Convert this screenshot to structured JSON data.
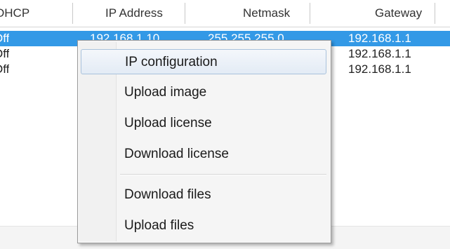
{
  "table": {
    "columns": [
      "DHCP",
      "IP Address",
      "Netmask",
      "Gateway"
    ],
    "rows": [
      {
        "dhcp": "Off",
        "ip": "192.168.1.10",
        "netmask": "255.255.255.0",
        "gateway": "192.168.1.1",
        "selected": true
      },
      {
        "dhcp": "Off",
        "ip": "",
        "netmask": "",
        "gateway": "192.168.1.1",
        "selected": false
      },
      {
        "dhcp": "Off",
        "ip": "",
        "netmask": "",
        "gateway": "192.168.1.1",
        "selected": false
      }
    ]
  },
  "context_menu": {
    "items": [
      {
        "label": "IP configuration",
        "hovered": true
      },
      {
        "label": "Upload image"
      },
      {
        "label": "Upload license"
      },
      {
        "label": "Download license"
      },
      {
        "label": "Download files"
      },
      {
        "label": "Upload files"
      }
    ]
  },
  "colors": {
    "selection": "#3399e6",
    "menu_background": "#f5f5f5",
    "menu_hover_border": "#a9c2dc"
  }
}
